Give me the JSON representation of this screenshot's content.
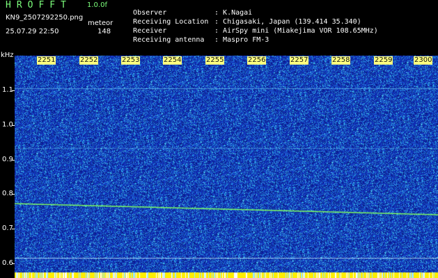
{
  "header": {
    "app_title": "HROFFT",
    "version": "1.0.0f",
    "file_name": "KN9_2507292250.png",
    "mode": "meteor",
    "timestamp": "25.07.29 22:50",
    "count": "148"
  },
  "station": [
    {
      "label": "Observer",
      "value": "K.Nagai"
    },
    {
      "label": "Receiving Location",
      "value": "Chigasaki, Japan (139.414 35.340)"
    },
    {
      "label": "Receiver",
      "value": "AirSpy mini (Miakejima VOR 108.65MHz)"
    },
    {
      "label": "Receiving antenna",
      "value": "Maspro FM-3"
    }
  ],
  "separator": ":",
  "axis": {
    "y_unit": "kHz",
    "y_ticks": [
      "1.1",
      "1.0",
      "0.9",
      "0.8",
      "0.7",
      "0.6"
    ],
    "time_labels": [
      "2251",
      "2252",
      "2253",
      "2254",
      "2255",
      "2256",
      "2257",
      "2258",
      "2259",
      "2300"
    ]
  },
  "colors": {
    "background": "#000000",
    "waterfall_base": "#1f3fcf",
    "noise_highlight": "#5fd9ff",
    "signal_line": "#7fff5f",
    "bottom_bar": "#ffee00",
    "time_label_bg": "#ffff7f",
    "title_green": "#7CFF7C"
  }
}
